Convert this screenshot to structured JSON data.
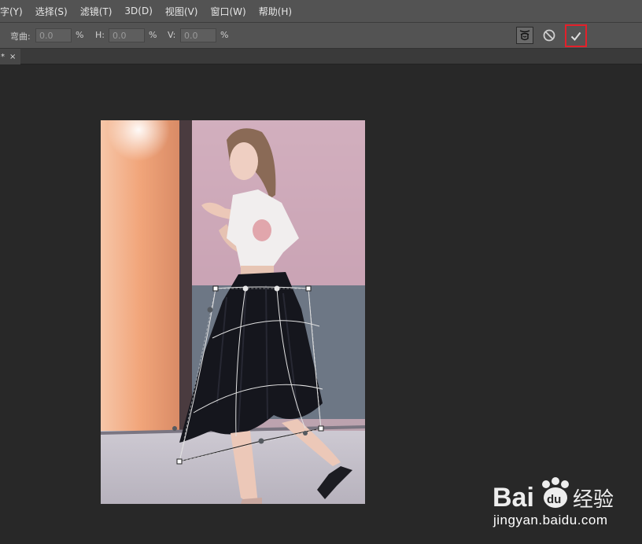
{
  "menu": {
    "items": [
      "字(Y)",
      "选择(S)",
      "滤镜(T)",
      "3D(D)",
      "视图(V)",
      "窗口(W)",
      "帮助(H)"
    ]
  },
  "options": {
    "bend_label": "弯曲:",
    "bend_value": "0.0",
    "h_label": "H:",
    "h_value": "0.0",
    "v_label": "V:",
    "v_value": "0.0",
    "percent": "%",
    "icons": {
      "warp_mode": "warp-mode-icon",
      "cancel": "cancel-transform-icon",
      "commit": "commit-check-icon"
    },
    "commit_highlight_color": "#e4202a"
  },
  "document": {
    "tab_label": "*",
    "close_glyph": "×"
  },
  "watermark": {
    "brand": "Bai",
    "brand2": "du",
    "suffix": "经验",
    "url": "jingyan.baidu.com"
  }
}
